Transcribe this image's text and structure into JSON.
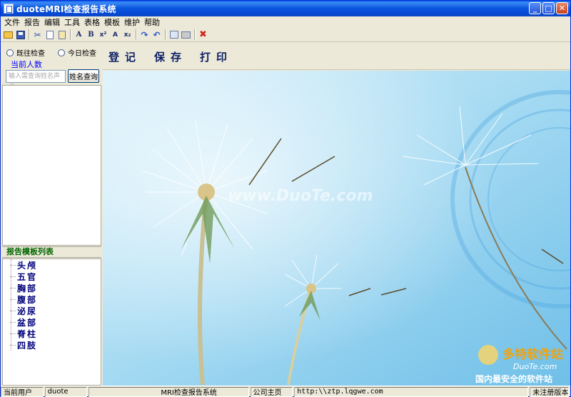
{
  "window": {
    "title": "duoteMRI检查报告系统"
  },
  "menu": [
    "文件",
    "报告",
    "编辑",
    "工具",
    "表格",
    "模板",
    "维护",
    "帮助"
  ],
  "toolbar": [
    {
      "icon": "open-folder-icon",
      "glyph": ""
    },
    {
      "icon": "save-disk-icon",
      "glyph": ""
    },
    {
      "icon": "cut-icon",
      "glyph": "✂"
    },
    {
      "icon": "copy-icon",
      "glyph": ""
    },
    {
      "icon": "paste-icon",
      "glyph": ""
    },
    {
      "icon": "font-color-icon",
      "glyph": "A"
    },
    {
      "icon": "bold-icon",
      "glyph": "B"
    },
    {
      "icon": "superscript-icon",
      "glyph": "x²"
    },
    {
      "icon": "font-size-icon",
      "glyph": "A"
    },
    {
      "icon": "subscript-icon",
      "glyph": "x₂"
    },
    {
      "icon": "redo-icon",
      "glyph": "↷"
    },
    {
      "icon": "undo-icon",
      "glyph": "↶"
    },
    {
      "icon": "table-icon",
      "glyph": ""
    },
    {
      "icon": "print-icon",
      "glyph": ""
    },
    {
      "icon": "exit-icon",
      "glyph": "✖"
    }
  ],
  "left": {
    "radio_history": "既往检查",
    "radio_today": "今日检查",
    "count_label": "当前人数",
    "search_placeholder": "输入需查询姓名声母",
    "search_button": "姓名查询",
    "templates_header": "报告模板列表",
    "templates": [
      "头颅",
      "五官",
      "胸部",
      "腹部",
      "泌尿",
      "盆部",
      "脊柱",
      "四肢"
    ]
  },
  "actions": [
    "登记",
    "保存",
    "打印"
  ],
  "canvas": {
    "watermark": "www.DuoTe.com",
    "brand_cn": "多特软件站",
    "brand_en": "DuoTe.com",
    "brand_slogan": "国内最安全的软件站"
  },
  "status": {
    "user_label": "当前用户",
    "user": "duote",
    "system": "MRI检查报告系统",
    "company_label": "公司主页",
    "url": "http:\\\\ztp.lqgwe.com",
    "version": "未注册版本"
  }
}
